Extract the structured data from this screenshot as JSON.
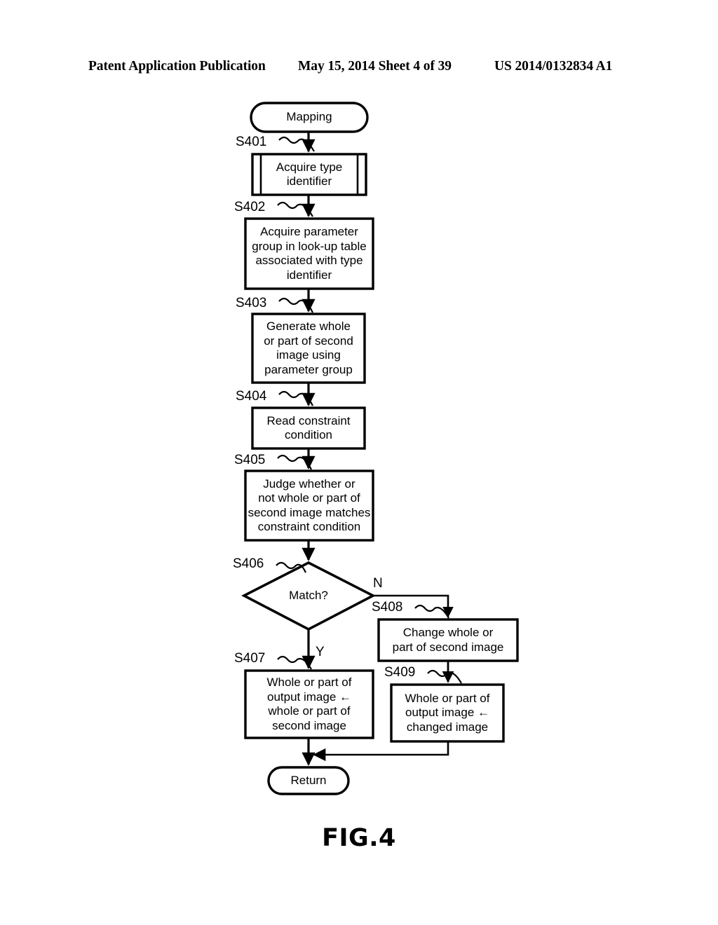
{
  "header": {
    "publication": "Patent Application Publication",
    "date_sheet": "May 15, 2014  Sheet 4 of 39",
    "patent_number": "US 2014/0132834 A1"
  },
  "figure": {
    "caption": "FIG.4"
  },
  "flowchart": {
    "start_node": {
      "label": "Mapping",
      "shape": "terminator"
    },
    "end_node": {
      "label": "Return",
      "shape": "terminator"
    },
    "decision": {
      "step": "S406",
      "label": "Match?",
      "shape": "diamond"
    },
    "branch_yes": "Y",
    "branch_no": "N",
    "steps": [
      {
        "step": "S401",
        "label": "Acquire type\nidentifier",
        "shape": "predefined-process"
      },
      {
        "step": "S402",
        "label": "Acquire parameter\ngroup in look-up table\nassociated with type\nidentifier",
        "shape": "process"
      },
      {
        "step": "S403",
        "label": "Generate whole\nor part of second\nimage using\nparameter group",
        "shape": "process"
      },
      {
        "step": "S404",
        "label": "Read constraint\ncondition",
        "shape": "process"
      },
      {
        "step": "S405",
        "label": "Judge whether or\nnot whole or part of\nsecond image matches\nconstraint condition",
        "shape": "process"
      },
      {
        "step": "S407",
        "label": "Whole or part of\noutput image ←\nwhole or part of\nsecond image",
        "shape": "process"
      },
      {
        "step": "S408",
        "label": "Change whole or\npart of second image",
        "shape": "process"
      },
      {
        "step": "S409",
        "label": "Whole or part of\noutput image ←\nchanged image",
        "shape": "process"
      }
    ]
  },
  "colors": {
    "ink": "#000000",
    "paper": "#ffffff"
  }
}
